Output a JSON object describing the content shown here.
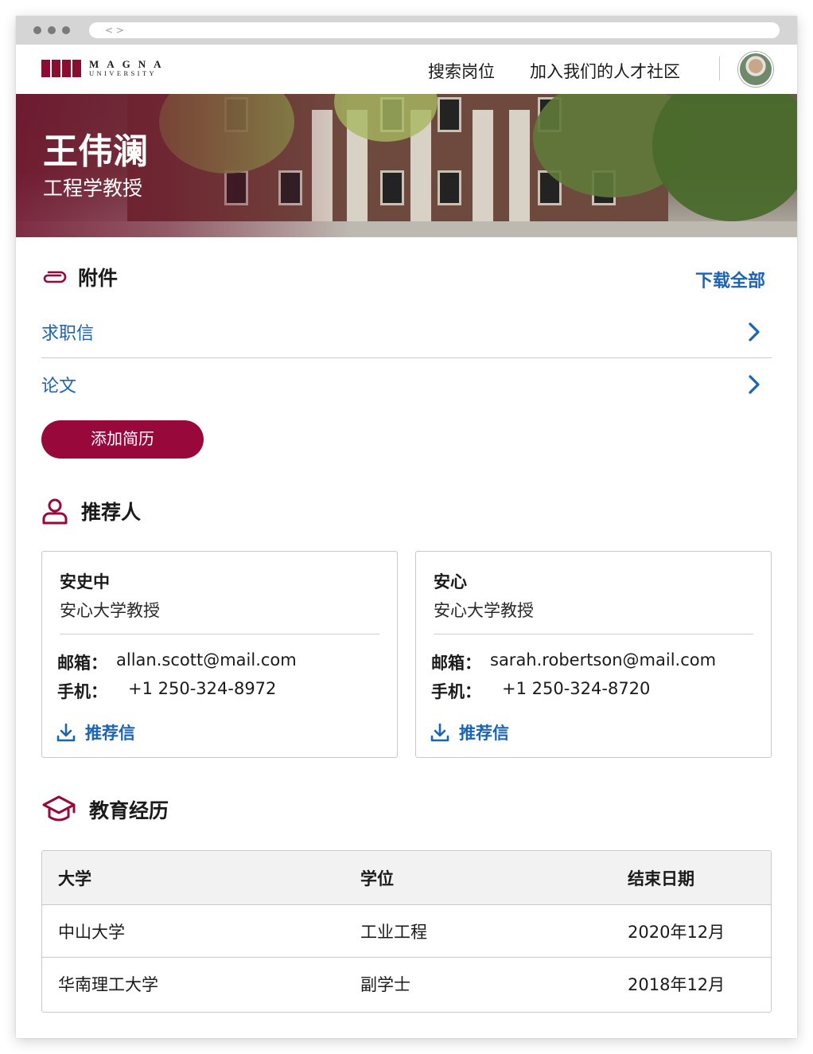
{
  "browser": {
    "url_glyph": "< >"
  },
  "header": {
    "logo_line1": "MAGNA",
    "logo_line2": "UNIVERSITY",
    "nav": [
      {
        "label": "搜索岗位"
      },
      {
        "label": "加入我们的人才社区"
      }
    ]
  },
  "hero": {
    "name": "王伟澜",
    "title": "工程学教授"
  },
  "attachments": {
    "title": "附件",
    "download_all": "下载全部",
    "items": [
      {
        "label": "求职信"
      },
      {
        "label": "论文"
      }
    ],
    "add_button": "添加简历"
  },
  "references": {
    "title": "推荐人",
    "email_label": "邮箱：",
    "phone_label": "手机：",
    "letter_label": "推荐信",
    "cards": [
      {
        "name": "安史中",
        "position": "安心大学教授",
        "email": "allan.scott@mail.com",
        "phone": "+1 250-324-8972"
      },
      {
        "name": "安心",
        "position": "安心大学教授",
        "email": "sarah.robertson@mail.com",
        "phone": "+1 250-324-8720"
      }
    ]
  },
  "education": {
    "title": "教育经历",
    "columns": [
      "大学",
      "学位",
      "结束日期"
    ],
    "rows": [
      [
        "中山大学",
        "工业工程",
        "2020年12月"
      ],
      [
        "华南理工大学",
        "副学士",
        "2018年12月"
      ]
    ]
  },
  "colors": {
    "brand": "#98083a",
    "link": "#1a64b4"
  },
  "icons": {
    "attachment": "paperclip-icon",
    "references": "person-icon",
    "education": "graduation-cap-icon",
    "row_action": "chevron-right-icon",
    "download": "download-icon"
  }
}
